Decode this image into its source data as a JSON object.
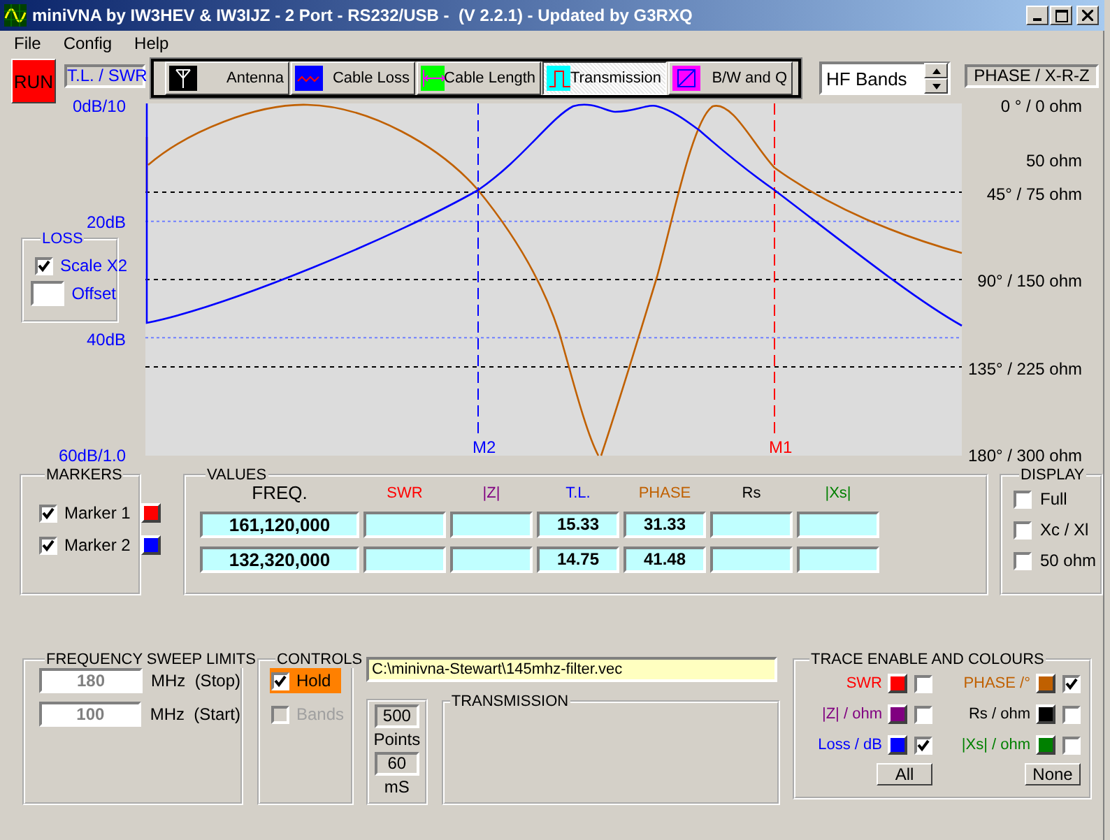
{
  "window": {
    "title": "miniVNA by IW3HEV & IW3IJZ - 2 Port - RS232/USB -  (V 2.2.1) - Updated by G3RXQ"
  },
  "menu": [
    "File",
    "Config",
    "Help"
  ],
  "run_button": "RUN",
  "left_scale": {
    "title": "T.L. / SWR",
    "labels": [
      "0dB/10",
      "20dB",
      "40dB",
      "60dB/1.0"
    ]
  },
  "modes": [
    {
      "label": "Antenna",
      "kind": "antenna",
      "selected": false
    },
    {
      "label": "Cable Loss",
      "kind": "cable_loss",
      "selected": false
    },
    {
      "label": "Cable Length",
      "kind": "cable_length",
      "selected": false
    },
    {
      "label": "Transmission",
      "kind": "transmission",
      "selected": true
    },
    {
      "label": "B/W and Q",
      "kind": "bw_q",
      "selected": false
    }
  ],
  "band_select": {
    "value": "HF Bands"
  },
  "right_scale": {
    "title": "PHASE / X-R-Z",
    "labels": [
      "0 ° / 0 ohm",
      "45° / 75 ohm",
      "90° / 150 ohm",
      "135° / 225 ohm",
      "180° / 300 ohm"
    ],
    "impedance_label": "50 ohm"
  },
  "plot": {
    "markers": [
      {
        "label": "M2",
        "color": "#0000ff"
      },
      {
        "label": "M1",
        "color": "#ff0000"
      }
    ]
  },
  "loss": {
    "title": "LOSS",
    "scale_x2": {
      "label": "Scale X2",
      "checked": true
    },
    "offset": {
      "label": "Offset"
    }
  },
  "markers": {
    "title": "MARKERS",
    "items": [
      {
        "label": "Marker 1",
        "checked": true,
        "color": "#ff0000"
      },
      {
        "label": "Marker 2",
        "checked": true,
        "color": "#0000ff"
      }
    ]
  },
  "values": {
    "title": "VALUES",
    "columns": [
      {
        "label": "FREQ.",
        "color": "#000000"
      },
      {
        "label": "SWR",
        "color": "#ff0000"
      },
      {
        "label": "|Z|",
        "color": "#800080"
      },
      {
        "label": "T.L.",
        "color": "#0000ff"
      },
      {
        "label": "PHASE",
        "color": "#c06000"
      },
      {
        "label": "Rs",
        "color": "#000000"
      },
      {
        "label": "|Xs|",
        "color": "#008000"
      }
    ],
    "rows": [
      [
        "161,120,000",
        null,
        null,
        "15.33",
        "31.33",
        null,
        null
      ],
      [
        "132,320,000",
        null,
        null,
        "14.75",
        "41.48",
        null,
        null
      ]
    ]
  },
  "display": {
    "title": "DISPLAY",
    "options": [
      {
        "label": "Full",
        "checked": false
      },
      {
        "label": "Xc / Xl",
        "checked": false
      },
      {
        "label": "50 ohm",
        "checked": false
      }
    ]
  },
  "sweep": {
    "title": "FREQUENCY SWEEP LIMITS",
    "fields": [
      {
        "value": "180",
        "unit": "MHz  (Stop)"
      },
      {
        "value": "100",
        "unit": "MHz  (Start)"
      }
    ]
  },
  "controls": {
    "title": "CONTROLS",
    "options": [
      {
        "label": "Hold",
        "checked": true,
        "disabled": false
      },
      {
        "label": "Bands",
        "checked": false,
        "disabled": true
      }
    ]
  },
  "file_path": "C:\\minivna-Stewart\\145mhz-filter.vec",
  "sampling": {
    "points": "500",
    "points_label": "Points",
    "time": "60",
    "time_label": "mS"
  },
  "transmission": {
    "title": "TRANSMISSION"
  },
  "traces": {
    "title": "TRACE ENABLE AND COLOURS",
    "items": [
      {
        "label": "SWR",
        "kind": "swr",
        "color": "#ff0000",
        "checked": false
      },
      {
        "label": "PHASE /°",
        "kind": "phase",
        "color": "#c06000",
        "checked": true
      },
      {
        "label": "|Z| / ohm",
        "kind": "z",
        "color": "#800080",
        "checked": false
      },
      {
        "label": "Rs / ohm",
        "kind": "rs",
        "color": "#000000",
        "checked": false
      },
      {
        "label": "Loss / dB",
        "kind": "loss",
        "color": "#0000ff",
        "checked": true
      },
      {
        "label": "|Xs| / ohm",
        "kind": "xs",
        "color": "#008000",
        "checked": false
      }
    ],
    "buttons": [
      "All",
      "None"
    ]
  }
}
